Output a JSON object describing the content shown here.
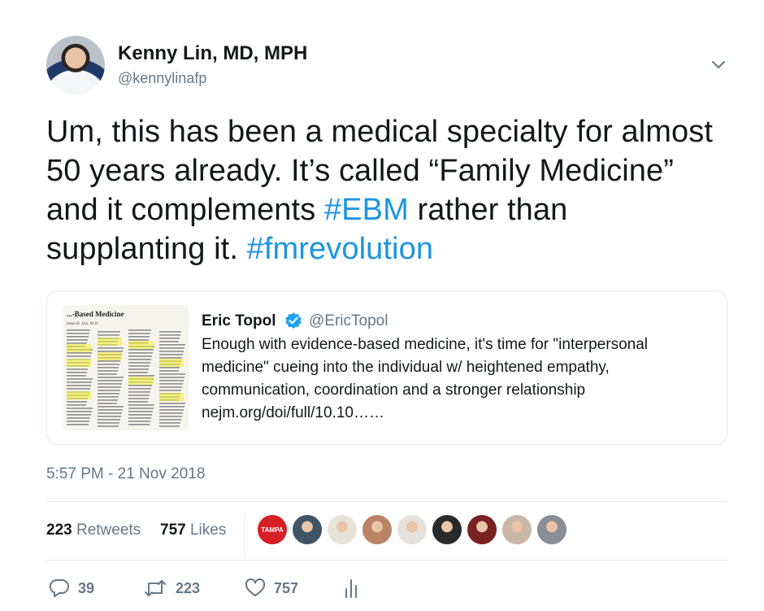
{
  "author": {
    "display_name": "Kenny Lin, MD, MPH",
    "handle": "@kennylinafp"
  },
  "tweet": {
    "text_parts": [
      {
        "text": "Um, this has been a medical specialty for almost 50 years already. It’s called “Family Medicine” and it complements ",
        "type": "text"
      },
      {
        "text": "#EBM",
        "type": "hashtag"
      },
      {
        "text": " rather than supplanting it. ",
        "type": "text"
      },
      {
        "text": "#fmrevolution",
        "type": "hashtag"
      }
    ]
  },
  "quoted_tweet": {
    "display_name": "Eric Topol",
    "handle": "@EricTopol",
    "verified": true,
    "body_lines": [
      "Enough with evidence-based medicine, it's time for \"interpersonal",
      "medicine\" cueing into the individual w/ heightened empathy,",
      "communication, coordination and a stronger relationship",
      "nejm.org/doi/full/10.10……"
    ],
    "thumbnail": {
      "heading": "...-Based Medicine",
      "author_line": "hetan H. Jain, M.D."
    }
  },
  "timestamp": "5:57 PM - 21 Nov 2018",
  "stats": {
    "retweets_count": "223",
    "retweets_label": "Retweets",
    "likes_count": "757",
    "likes_label": "Likes"
  },
  "likers": {
    "first_badge": "TAMPA",
    "colors": [
      "#d71f26",
      "#3f5566",
      "#e7e3d8",
      "#b98366",
      "#e6e1dc",
      "#2a2a2a",
      "#7a2222",
      "#c9b8a6",
      "#8a8f96"
    ]
  },
  "actions": {
    "reply_count": "39",
    "retweet_count": "223",
    "like_count": "757"
  },
  "colors": {
    "hashtag": "#1b95e0",
    "secondary_text": "#657786",
    "verified": "#1da1f2",
    "divider": "#e6ecf0"
  },
  "icons": [
    "chevron-down-icon",
    "verified-badge-icon",
    "reply-icon",
    "retweet-icon",
    "like-icon",
    "analytics-icon"
  ]
}
